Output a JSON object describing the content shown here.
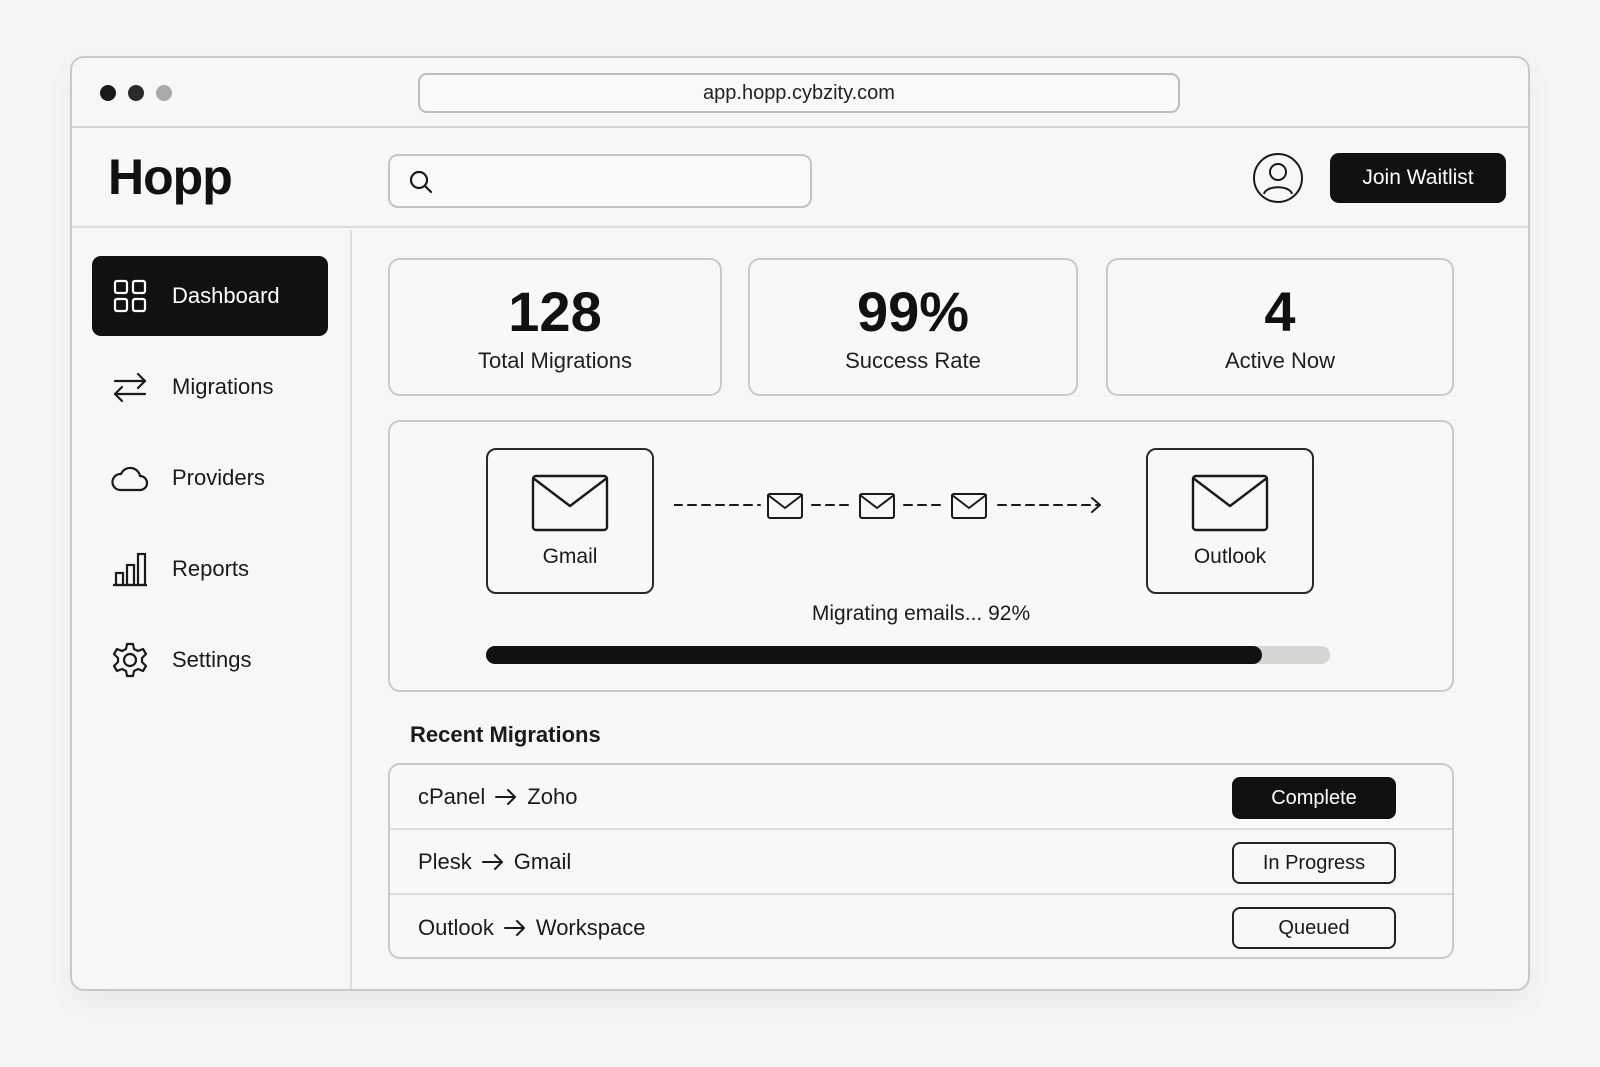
{
  "browser": {
    "url": "app.hopp.cybzity.com"
  },
  "header": {
    "brand": "Hopp",
    "search_placeholder": "",
    "join_label": "Join Waitlist"
  },
  "sidebar": {
    "items": [
      {
        "label": "Dashboard",
        "icon": "grid-icon",
        "active": true
      },
      {
        "label": "Migrations",
        "icon": "swap-arrows-icon",
        "active": false
      },
      {
        "label": "Providers",
        "icon": "cloud-icon",
        "active": false
      },
      {
        "label": "Reports",
        "icon": "bar-chart-icon",
        "active": false
      },
      {
        "label": "Settings",
        "icon": "gear-icon",
        "active": false
      }
    ]
  },
  "stats": [
    {
      "value": "128",
      "label": "Total Migrations"
    },
    {
      "value": "99%",
      "label": "Success Rate"
    },
    {
      "value": "4",
      "label": "Active Now"
    }
  ],
  "migration": {
    "source": "Gmail",
    "destination": "Outlook",
    "status_text": "Migrating emails... 92%",
    "progress": 0.92
  },
  "recent": {
    "title": "Recent Migrations",
    "rows": [
      {
        "from": "cPanel",
        "to": "Zoho",
        "status": "Complete",
        "style": "solid"
      },
      {
        "from": "Plesk",
        "to": "Gmail",
        "status": "In Progress",
        "style": "outline"
      },
      {
        "from": "Outlook",
        "to": "Workspace",
        "status": "Queued",
        "style": "outline"
      }
    ]
  },
  "colors": {
    "accent": "#111111",
    "background": "#f6f6f4",
    "border": "#c9c9c6",
    "track": "#d6d6d3"
  }
}
